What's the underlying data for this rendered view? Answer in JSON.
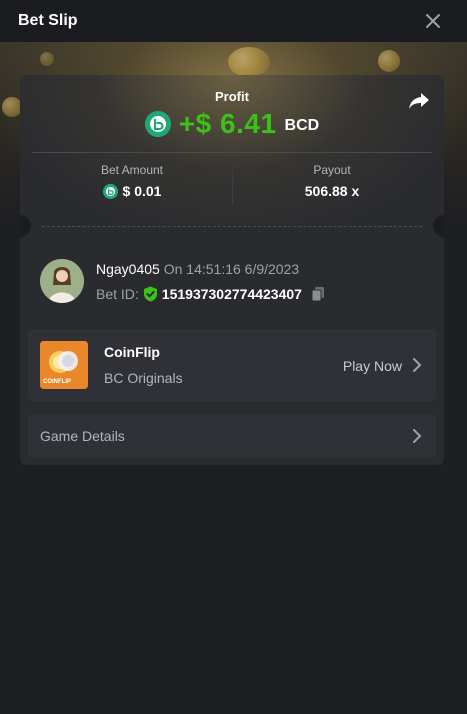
{
  "header": {
    "title": "Bet Slip",
    "close_icon": "close-icon"
  },
  "profit": {
    "label": "Profit",
    "value": "+$ 6.41",
    "currency": "BCD",
    "color": "#3bc117",
    "coin_icon": "bc-coin-icon",
    "share_icon": "share-icon"
  },
  "stats": {
    "bet_amount_label": "Bet Amount",
    "bet_amount_value": "$ 0.01",
    "payout_label": "Payout",
    "payout_value": "506.88 x"
  },
  "bet": {
    "username": "Ngay0405",
    "time_text": "On 14:51:16 6/9/2023",
    "bet_id_label": "Bet ID:",
    "bet_id_value": "151937302774423407",
    "verified_icon": "shield-check-icon",
    "copy_icon": "copy-icon"
  },
  "game": {
    "thumb_text": "COINFLIP",
    "name": "CoinFlip",
    "provider": "BC Originals",
    "play_label": "Play Now"
  },
  "details": {
    "label": "Game Details"
  },
  "colors": {
    "background": "#1e1f22",
    "card": "#2a2b2f",
    "row": "#303136",
    "accent_green": "#3bc117",
    "bc_green": "#21a678"
  }
}
